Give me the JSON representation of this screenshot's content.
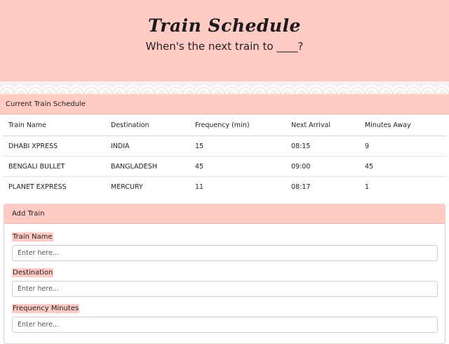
{
  "header": {
    "title": "Train Schedule",
    "subtitle": "When's the next train to ____?"
  },
  "schedule": {
    "panel_title": "Current Train Schedule",
    "columns": [
      "Train Name",
      "Destination",
      "Frequency (min)",
      "Next Arrival",
      "Minutes Away"
    ],
    "rows": [
      [
        "DHABI XPRESS",
        "INDIA",
        "15",
        "08:15",
        "9"
      ],
      [
        "BENGALI BULLET",
        "BANGLADESH",
        "45",
        "09:00",
        "45"
      ],
      [
        "PLANET EXPRESS",
        "MERCURY",
        "11",
        "08:17",
        "1"
      ]
    ]
  },
  "add_train": {
    "title": "Add Train",
    "fields": [
      {
        "label": "Train Name",
        "placeholder": "Enter here..."
      },
      {
        "label": "Destination",
        "placeholder": "Enter here..."
      },
      {
        "label": "Frequency Minutes",
        "placeholder": "Enter here..."
      }
    ]
  },
  "colors": {
    "accent": "#ffcbc4",
    "border": "#e4e4e4"
  }
}
